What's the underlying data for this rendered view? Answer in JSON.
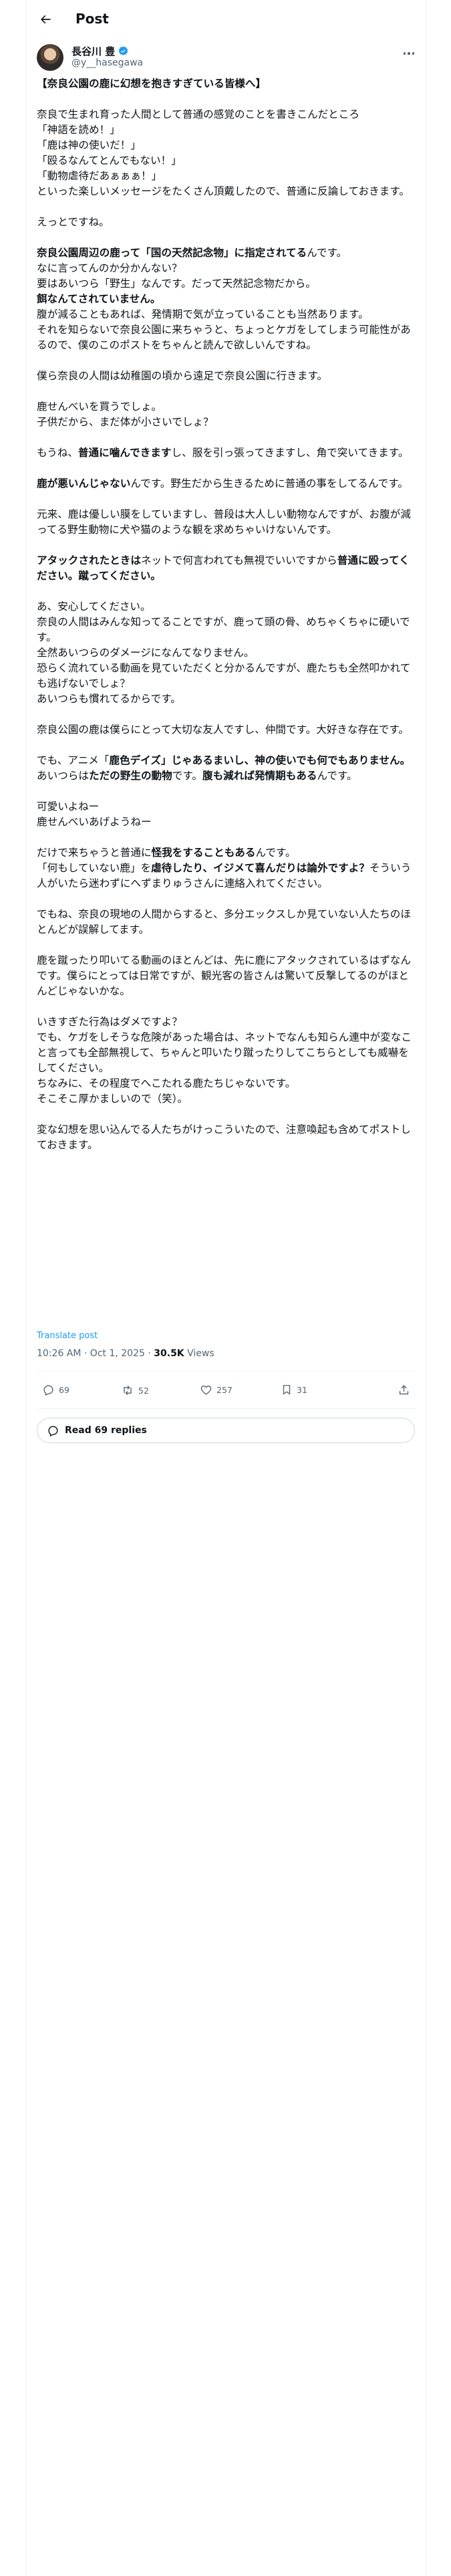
{
  "header": {
    "title": "Post"
  },
  "author": {
    "name": "長谷川 豊",
    "handle": "@y__hasegawa"
  },
  "post": {
    "paragraphs": [
      {
        "lines": [
          [
            {
              "t": "【奈良公園の鹿に幻想を抱きすぎている皆様へ】",
              "b": true
            }
          ]
        ]
      },
      {
        "lines": [
          [
            {
              "t": "奈良で生まれ育った人間として普通の感覚のことを書きこんだところ"
            }
          ],
          [
            {
              "t": "「神語を読め！」"
            }
          ],
          [
            {
              "t": "「鹿は神の使いだ！」"
            }
          ],
          [
            {
              "t": "「殴るなんてとんでもない！」"
            }
          ],
          [
            {
              "t": "「動物虐待だあぁぁぁ！」"
            }
          ],
          [
            {
              "t": "といった楽しいメッセージをたくさん頂戴したので、普通に反論しておきます。"
            }
          ]
        ]
      },
      {
        "lines": [
          [
            {
              "t": "えっとですね。"
            }
          ]
        ]
      },
      {
        "lines": [
          [
            {
              "t": "奈良公園周辺の鹿って「国の天然記念物」に指定されてる",
              "b": true
            },
            {
              "t": "んです。"
            }
          ],
          [
            {
              "t": "なに言ってんのか分かんない？"
            }
          ],
          [
            {
              "t": "要はあいつら「野生」なんです。だって天然記念物だから。"
            }
          ],
          [
            {
              "t": "餌なんてされていません。",
              "b": true
            }
          ],
          [
            {
              "t": "腹が減ることもあれば、発情期で気が立っていることも当然あります。"
            }
          ],
          [
            {
              "t": "それを知らないで奈良公園に来ちゃうと、ちょっとケガをしてしまう可能性があるので、僕のこのポストをちゃんと読んで欲しいんですね。"
            }
          ]
        ]
      },
      {
        "lines": [
          [
            {
              "t": "僕ら奈良の人間は幼稚園の頃から遠足で奈良公園に行きます。"
            }
          ]
        ]
      },
      {
        "lines": [
          [
            {
              "t": "鹿せんべいを買うでしょ。"
            }
          ],
          [
            {
              "t": "子供だから、まだ体が小さいでしょ？"
            }
          ]
        ]
      },
      {
        "lines": [
          [
            {
              "t": "もうね、"
            },
            {
              "t": "普通に噛んできます",
              "b": true
            },
            {
              "t": "し、服を引っ張ってきますし、角で突いてきます。"
            }
          ]
        ]
      },
      {
        "lines": [
          [
            {
              "t": "鹿が悪いんじゃない",
              "b": true
            },
            {
              "t": "んです。野生だから生きるために普通の事をしてるんです。"
            }
          ]
        ]
      },
      {
        "lines": [
          [
            {
              "t": "元来、鹿は優しい膜をしていますし、普段は大人しい動物なんですが、お腹が減ってる野生動物に犬や猫のような観を求めちゃいけないんです。"
            }
          ]
        ]
      },
      {
        "lines": [
          [
            {
              "t": "アタックされたときは",
              "b": true
            },
            {
              "t": "ネットで何言われても無視でいいですから"
            },
            {
              "t": "普通に殴ってください。蹴ってください。",
              "b": true
            }
          ]
        ]
      },
      {
        "lines": [
          [
            {
              "t": "あ、安心してください。"
            }
          ],
          [
            {
              "t": "奈良の人間はみんな知ってることですが、鹿って頭の骨、めちゃくちゃに硬いです。"
            }
          ],
          [
            {
              "t": "全然あいつらのダメージになんてなりません。"
            }
          ],
          [
            {
              "t": "恐らく流れている動画を見ていただくと分かるんですが、鹿たちも全然叩かれても逃げないでしょ？"
            }
          ],
          [
            {
              "t": "あいつらも慣れてるからです。"
            }
          ]
        ]
      },
      {
        "lines": [
          [
            {
              "t": "奈良公園の鹿は僕らにとって大切な友人ですし、仲間です。大好きな存在です。"
            }
          ]
        ]
      },
      {
        "lines": [
          [
            {
              "t": "でも、アニメ「"
            },
            {
              "t": "鹿色デイズ」じゃあるまいし、神の使いでも何でもありません。",
              "b": true
            },
            {
              "t": "あいつらは"
            },
            {
              "t": "ただの野生の動物",
              "b": true
            },
            {
              "t": "です。"
            },
            {
              "t": "腹も減れば発情期もある",
              "b": true
            },
            {
              "t": "んです。"
            }
          ]
        ]
      },
      {
        "lines": [
          [
            {
              "t": "可愛いよねー"
            }
          ],
          [
            {
              "t": "鹿せんべいあげようねー"
            }
          ]
        ]
      },
      {
        "lines": [
          [
            {
              "t": "だけで来ちゃうと普通に"
            },
            {
              "t": "怪我をすることもある",
              "b": true
            },
            {
              "t": "んです。"
            }
          ],
          [
            {
              "t": "「何もしていない鹿」を"
            },
            {
              "t": "虐待したり、イジメて喜んだりは論外ですよ？",
              "b": true
            },
            {
              "t": "そういう人がいたら迷わずにへずまりゅうさんに連絡入れてください。"
            }
          ]
        ]
      },
      {
        "lines": [
          [
            {
              "t": "でもね、奈良の現地の人間からすると、多分エックスしか見ていない人たちのほとんどが誤解してます。"
            }
          ]
        ]
      },
      {
        "lines": [
          [
            {
              "t": "鹿を蹴ったり叩いてる動画のほとんどは、先に鹿にアタックされているはずなんです。僕らにとっては日常ですが、観光客の皆さんは驚いて反撃してるのがほとんどじゃないかな。"
            }
          ]
        ]
      },
      {
        "lines": [
          [
            {
              "t": "いきすぎた行為はダメですよ？"
            }
          ],
          [
            {
              "t": "でも、ケガをしそうな危険があった場合は、ネットでなんも知らん連中が変なこと言っても全部無視して、ちゃんと叩いたり蹴ったりしてこちらとしても威嚇をしてください。"
            }
          ],
          [
            {
              "t": "ちなみに、その程度でへこたれる鹿たちじゃないです。"
            }
          ],
          [
            {
              "t": "そこそこ厚かましいので（笑）。"
            }
          ]
        ]
      },
      {
        "lines": [
          [
            {
              "t": "変な幻想を思い込んでる人たちがけっこういたので、注意喚起も含めてポストしておきます。"
            }
          ]
        ]
      }
    ],
    "translate_label": "Translate post",
    "timestamp": "10:26 AM · Oct 1, 2025",
    "separator": " · ",
    "views_count": "30.5K",
    "views_label": " Views"
  },
  "actions": {
    "replies": "69",
    "reposts": "52",
    "likes": "257",
    "bookmarks": "31"
  },
  "read_replies": "Read 69 replies",
  "colors": {
    "accent": "#1d9bf0",
    "text": "#0f1419",
    "muted": "#536471",
    "border": "#eff3f4"
  }
}
